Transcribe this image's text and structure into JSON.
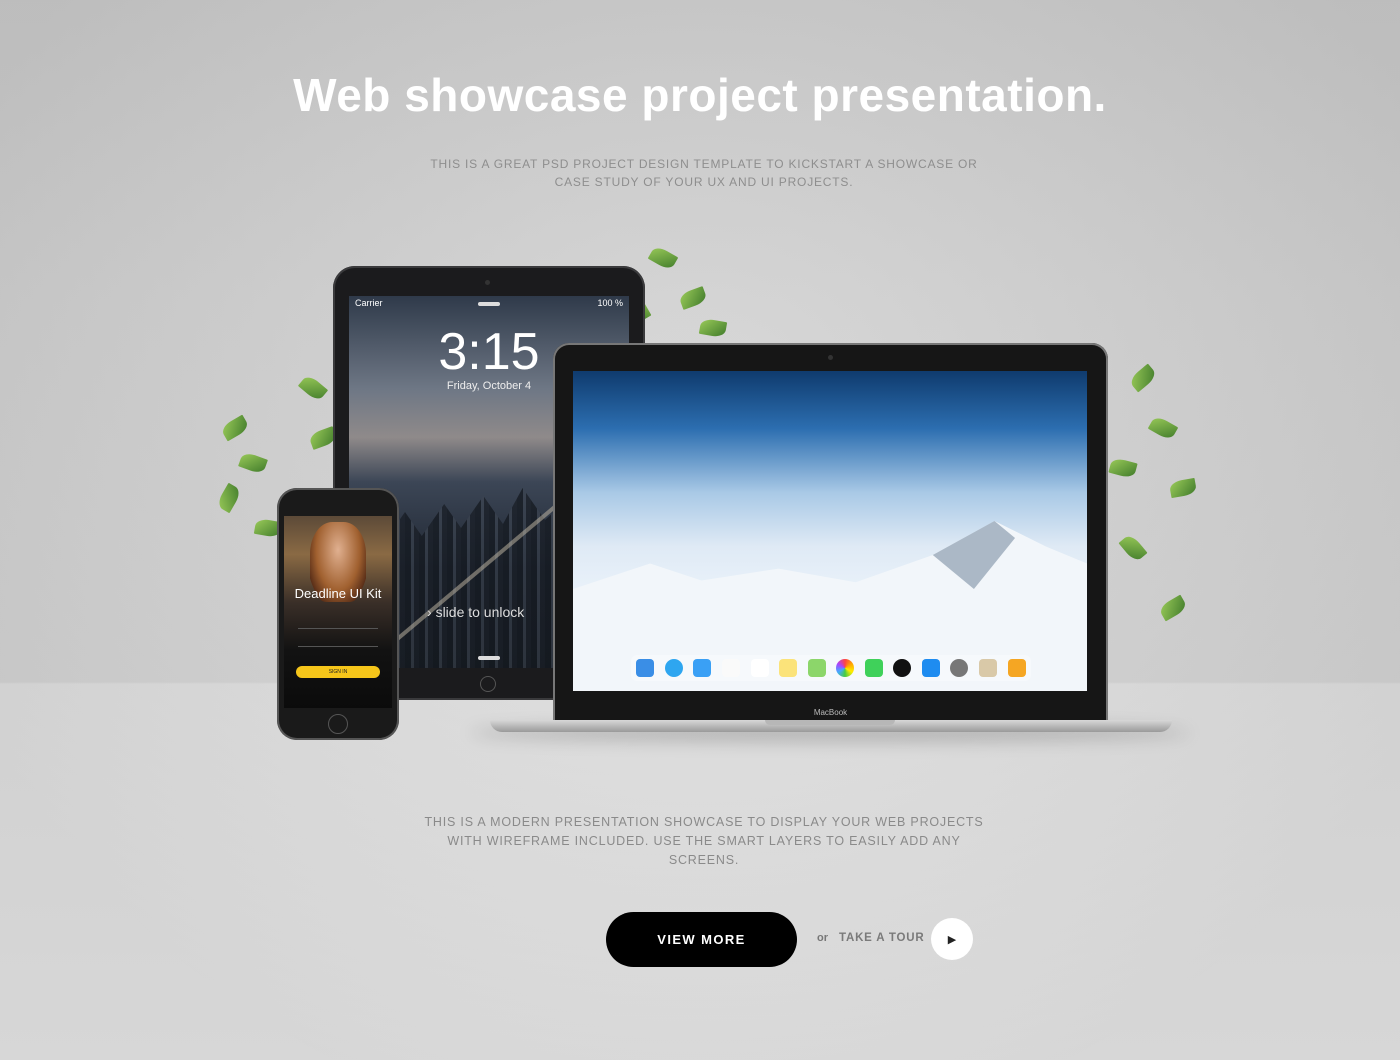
{
  "hero": {
    "title": "Web showcase project presentation.",
    "subtitle": "THIS IS A GREAT PSD PROJECT DESIGN TEMPLATE TO KICKSTART A SHOWCASE OR CASE STUDY OF YOUR UX AND UI PROJECTS."
  },
  "ipad": {
    "carrier": "Carrier",
    "battery": "100 %",
    "time": "3:15",
    "date": "Friday, October 4",
    "unlock": "slide to unlock"
  },
  "iphone": {
    "app_title": "Deadline UI Kit",
    "button": "SIGN IN"
  },
  "macbook": {
    "label": "MacBook",
    "dock_icons": [
      "finder-icon",
      "safari-icon",
      "mail-icon",
      "music-icon",
      "calendar-icon",
      "notes-icon",
      "maps-icon",
      "photos-icon",
      "messages-icon",
      "clock-icon",
      "appstore-icon",
      "settings-icon",
      "contacts-icon",
      "home-icon"
    ]
  },
  "description": "THIS IS A MODERN PRESENTATION SHOWCASE TO DISPLAY YOUR WEB PROJECTS WITH WIREFRAME INCLUDED. USE THE SMART LAYERS TO EASILY ADD ANY SCREENS.",
  "actions": {
    "view_more": "VIEW MORE",
    "or": "or",
    "take_tour": "TAKE A TOUR",
    "play_icon": "play-icon"
  },
  "colors": {
    "primary_button": "#000000",
    "accent_yellow": "#f6c61a"
  }
}
